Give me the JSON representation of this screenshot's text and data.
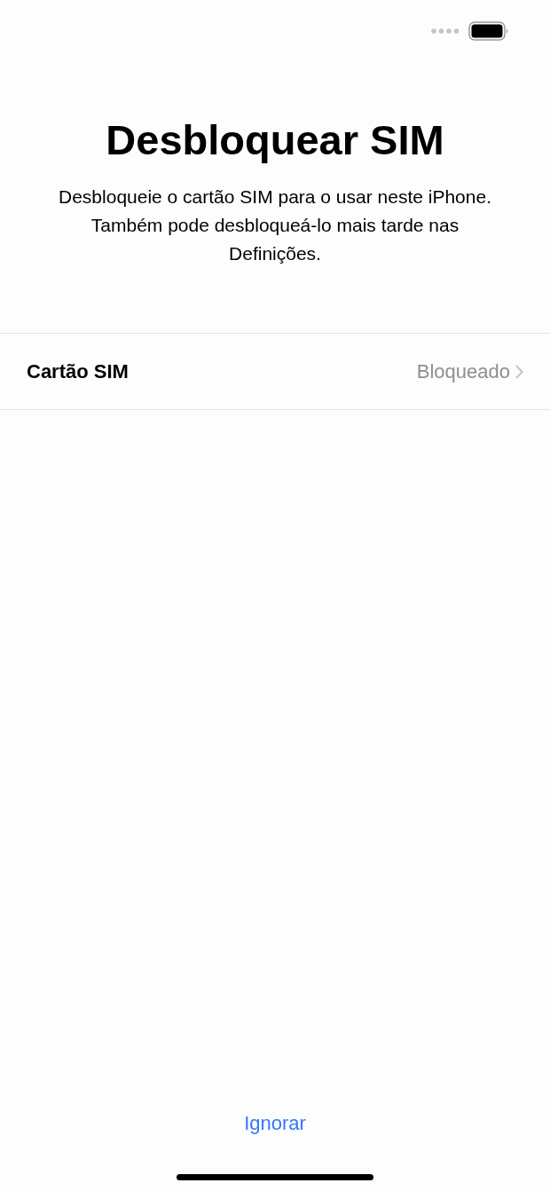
{
  "title": "Desbloquear SIM",
  "description": "Desbloqueie o cartão SIM para o usar neste iPhone. Também pode desbloqueá-lo mais tarde nas Definições.",
  "row": {
    "label": "Cartão SIM",
    "value": "Bloqueado"
  },
  "skip_button": "Ignorar"
}
